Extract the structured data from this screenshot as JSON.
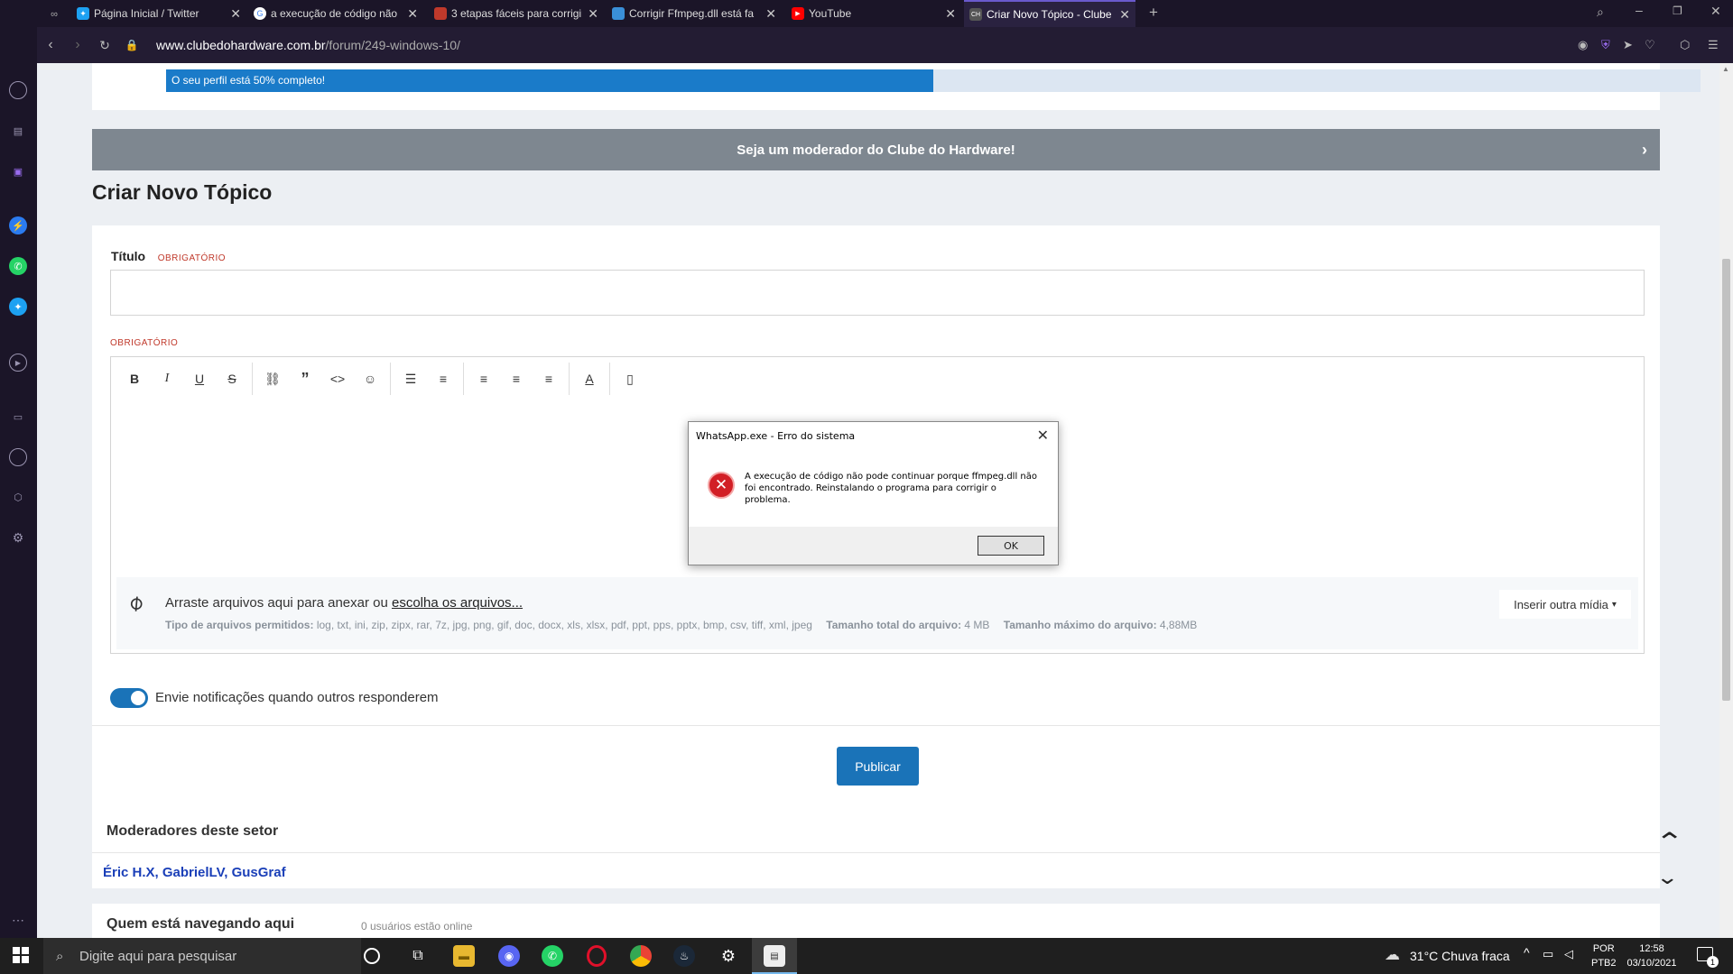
{
  "browser": {
    "tabs": [
      {
        "title": "Página Inicial / Twitter",
        "icon": "twitter-icon"
      },
      {
        "title": "a execução de código não",
        "icon": "google-icon"
      },
      {
        "title": "3 etapas fáceis para corrigir",
        "icon": "site-icon"
      },
      {
        "title": "Corrigir Ffmpeg.dll está fa",
        "icon": "site-icon"
      },
      {
        "title": "YouTube",
        "icon": "youtube-icon"
      },
      {
        "title": "Criar Novo Tópico - Clube",
        "icon": "cdh-icon"
      }
    ],
    "url_domain": "www.clubedohardware.com.br",
    "url_path": "/forum/249-windows-10/"
  },
  "profile": {
    "progress_text": "O seu perfil está 50% completo!",
    "progress_pct": 50
  },
  "banner": {
    "text": "Seja um moderador do Clube do Hardware!"
  },
  "form": {
    "page_title": "Criar Novo Tópico",
    "title_label": "Título",
    "required": "OBRIGATÓRIO",
    "attach_text": "Arraste arquivos aqui para anexar ou",
    "attach_link": "escolha os arquivos...",
    "types_label": "Tipo de arquivos permitidos:",
    "types_value": "log, txt, ini, zip, zipx, rar, 7z, jpg, png, gif, doc, docx, xls, xlsx, pdf, ppt, pps, pptx, bmp, csv, tiff, xml, jpeg",
    "total_label": "Tamanho total do arquivo:",
    "total_value": "4 MB",
    "max_label": "Tamanho máximo do arquivo:",
    "max_value": "4,88MB",
    "insert_media": "Inserir outra mídia",
    "notify_text": "Envie notificações quando outros responderem",
    "publish": "Publicar"
  },
  "moderators": {
    "heading": "Moderadores deste setor",
    "names": [
      "Éric H.X",
      "GabrielLV",
      "GusGraf"
    ]
  },
  "browsing": {
    "heading": "Quem está navegando aqui",
    "count": "0 usuários estão online"
  },
  "dialog": {
    "title": "WhatsApp.exe - Erro do sistema",
    "message": "A execução de código não pode continuar porque ffmpeg.dll não foi encontrado. Reinstalando o programa para corrigir o problema.",
    "ok": "OK"
  },
  "taskbar": {
    "search_placeholder": "Digite aqui para pesquisar",
    "weather": "31°C  Chuva fraca",
    "lang1": "POR",
    "lang2": "PTB2",
    "time": "12:58",
    "date": "03/10/2021",
    "notif_count": "1"
  }
}
